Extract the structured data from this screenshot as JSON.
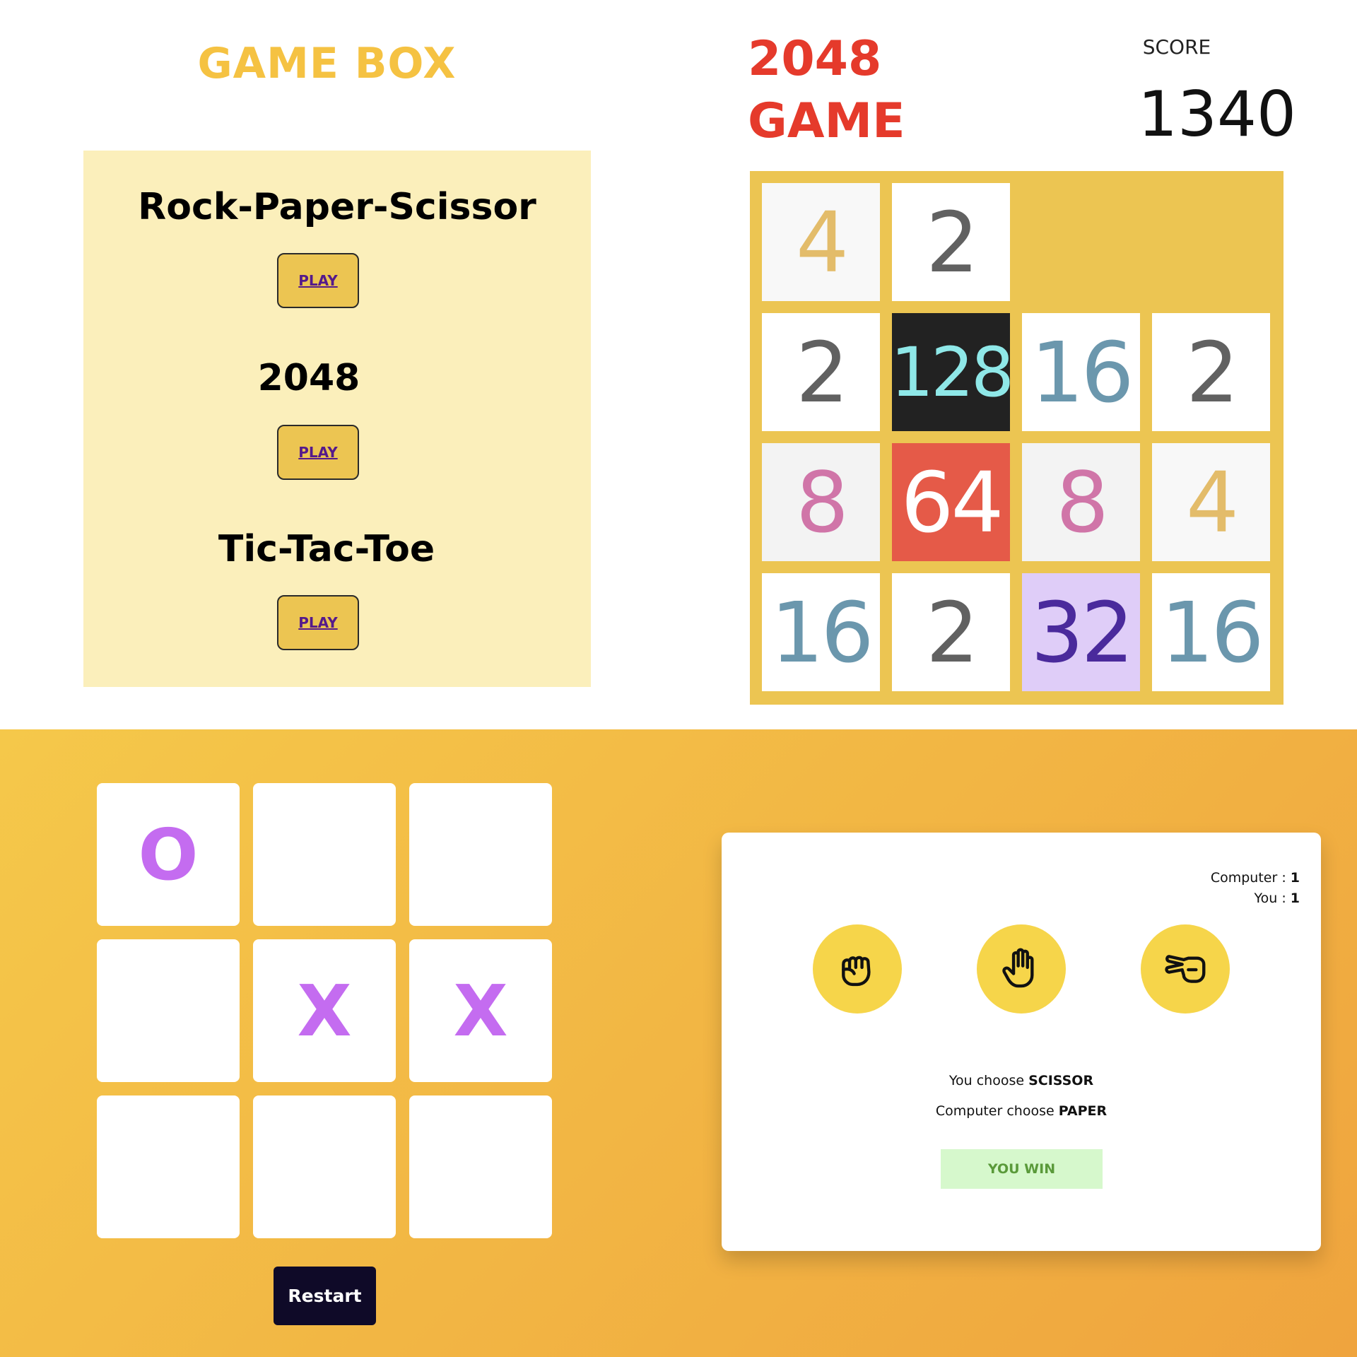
{
  "game_box": {
    "title": "GAME BOX",
    "games": [
      {
        "name": "Rock-Paper-Scissor",
        "button": "PLAY"
      },
      {
        "name": "2048",
        "button": "PLAY"
      },
      {
        "name": "Tic-Tac-Toe",
        "button": "PLAY"
      }
    ]
  },
  "game2048": {
    "title_line1": "2048",
    "title_line2": "GAME",
    "score_label": "SCORE",
    "score": "1340",
    "grid": [
      [
        "4",
        "2",
        "",
        ""
      ],
      [
        "2",
        "128",
        "16",
        "2"
      ],
      [
        "8",
        "64",
        "8",
        "4"
      ],
      [
        "16",
        "2",
        "32",
        "16"
      ]
    ]
  },
  "tictactoe": {
    "cells": [
      "O",
      "",
      "",
      "",
      "X",
      "X",
      "",
      "",
      ""
    ],
    "restart_label": "Restart"
  },
  "rps": {
    "computer_label": "Computer : ",
    "computer_score": "1",
    "you_label": "You : ",
    "you_score": "1",
    "choices": [
      "rock",
      "paper",
      "scissor"
    ],
    "you_choose_prefix": "You choose ",
    "you_choice": "SCISSOR",
    "computer_choose_prefix": "Computer choose ",
    "computer_choice": "PAPER",
    "result": "YOU WIN"
  }
}
